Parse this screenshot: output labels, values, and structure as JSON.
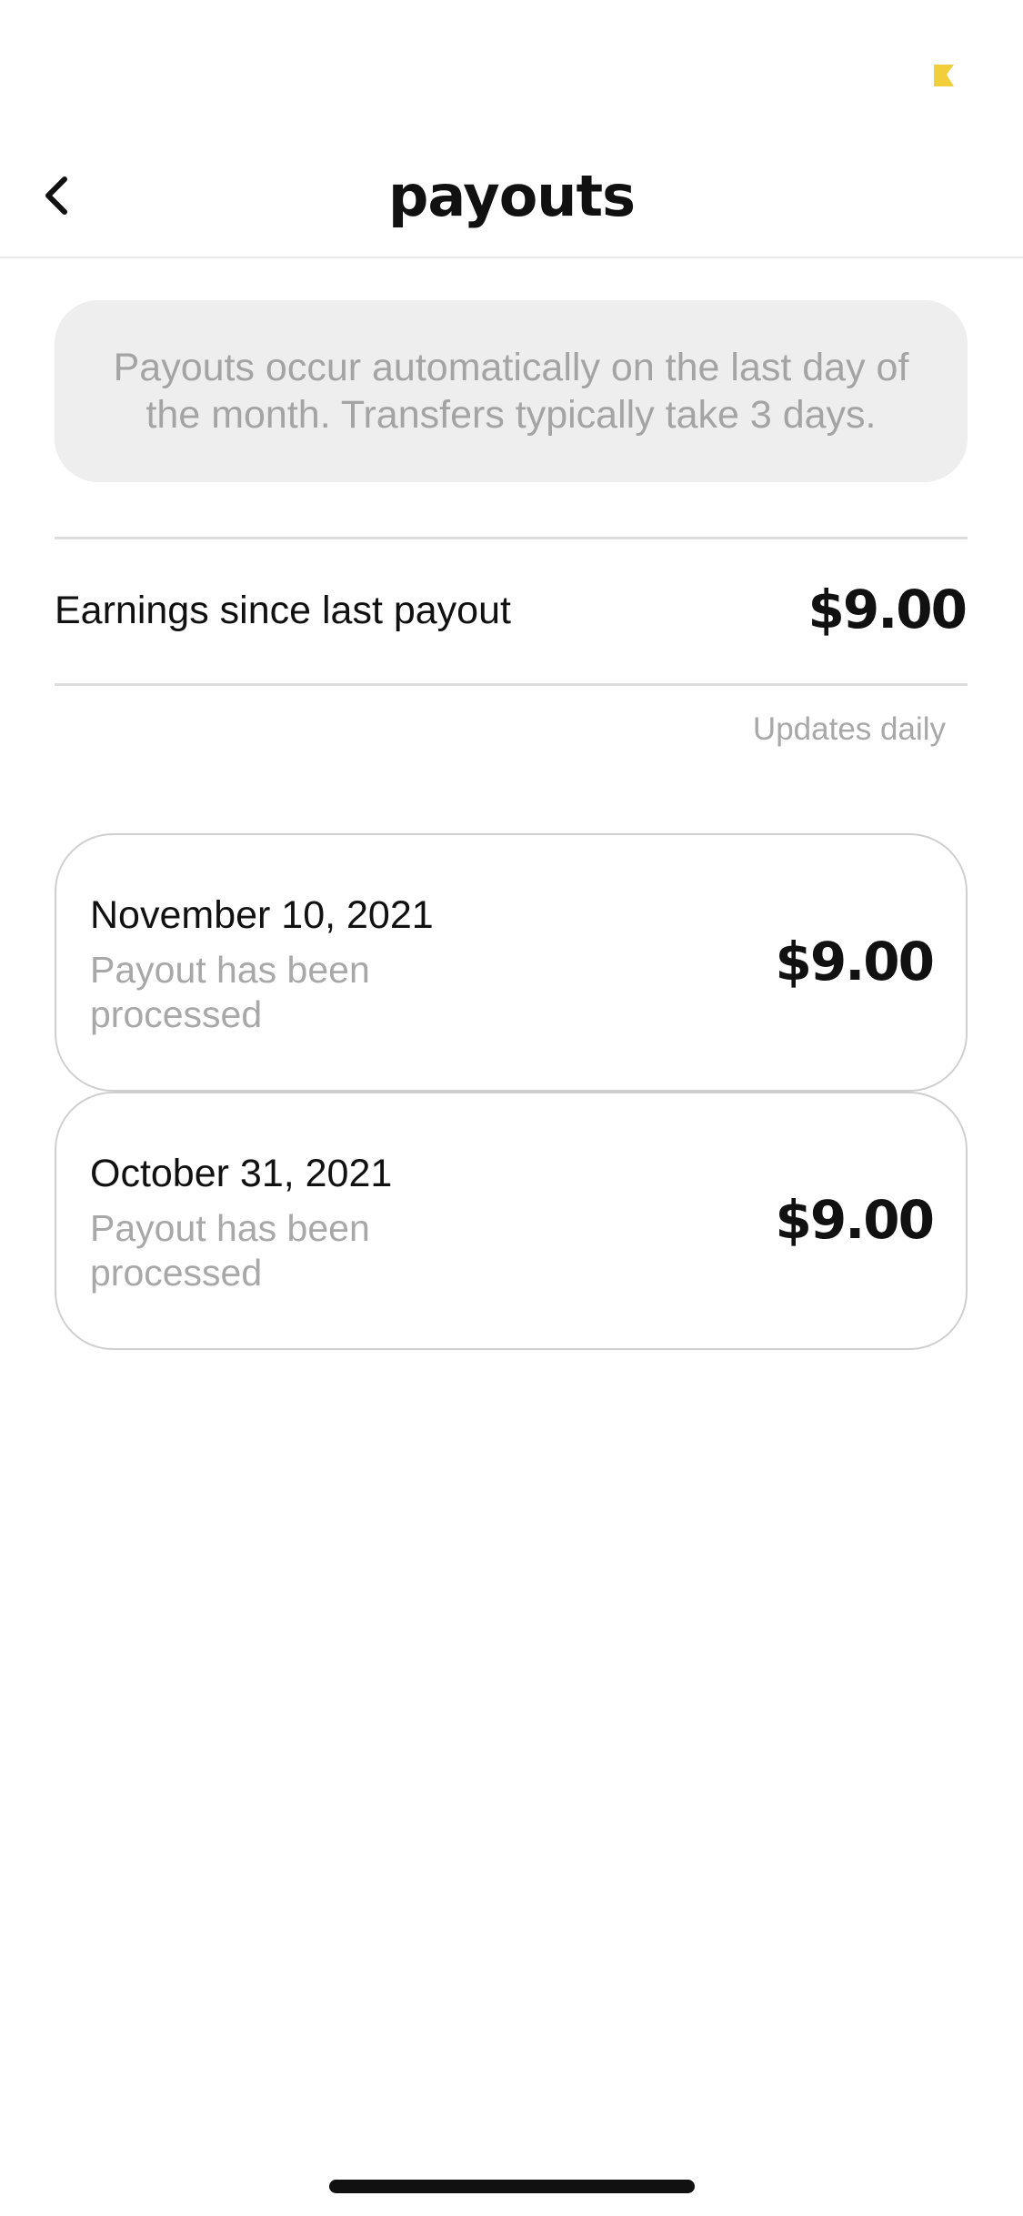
{
  "status_bar": {
    "indicator_icon": "flag-icon",
    "indicator_color": "#f2cf3a"
  },
  "header": {
    "title": "payouts",
    "back_icon": "chevron-left-icon"
  },
  "info_banner": {
    "text": "Payouts occur automatically on the last day of the month. Transfers typically take 3 days."
  },
  "earnings": {
    "label": "Earnings since last payout",
    "amount": "$9.00",
    "note": "Updates daily"
  },
  "payouts": [
    {
      "date": "November 10, 2021",
      "status": "Payout has been processed",
      "amount": "$9.00"
    },
    {
      "date": "October 31, 2021",
      "status": "Payout has been processed",
      "amount": "$9.00"
    }
  ],
  "colors": {
    "banner_background": "#eeeeee",
    "muted_text": "#a8a8a8",
    "primary_text": "#111111",
    "divider": "#dedede"
  }
}
